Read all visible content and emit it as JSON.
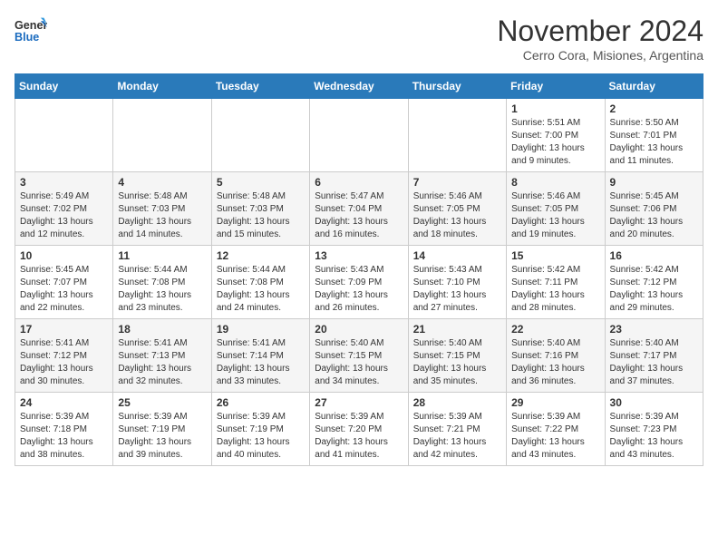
{
  "header": {
    "logo_line1": "General",
    "logo_line2": "Blue",
    "month": "November 2024",
    "location": "Cerro Cora, Misiones, Argentina"
  },
  "weekdays": [
    "Sunday",
    "Monday",
    "Tuesday",
    "Wednesday",
    "Thursday",
    "Friday",
    "Saturday"
  ],
  "weeks": [
    [
      {
        "day": "",
        "info": ""
      },
      {
        "day": "",
        "info": ""
      },
      {
        "day": "",
        "info": ""
      },
      {
        "day": "",
        "info": ""
      },
      {
        "day": "",
        "info": ""
      },
      {
        "day": "1",
        "info": "Sunrise: 5:51 AM\nSunset: 7:00 PM\nDaylight: 13 hours\nand 9 minutes."
      },
      {
        "day": "2",
        "info": "Sunrise: 5:50 AM\nSunset: 7:01 PM\nDaylight: 13 hours\nand 11 minutes."
      }
    ],
    [
      {
        "day": "3",
        "info": "Sunrise: 5:49 AM\nSunset: 7:02 PM\nDaylight: 13 hours\nand 12 minutes."
      },
      {
        "day": "4",
        "info": "Sunrise: 5:48 AM\nSunset: 7:03 PM\nDaylight: 13 hours\nand 14 minutes."
      },
      {
        "day": "5",
        "info": "Sunrise: 5:48 AM\nSunset: 7:03 PM\nDaylight: 13 hours\nand 15 minutes."
      },
      {
        "day": "6",
        "info": "Sunrise: 5:47 AM\nSunset: 7:04 PM\nDaylight: 13 hours\nand 16 minutes."
      },
      {
        "day": "7",
        "info": "Sunrise: 5:46 AM\nSunset: 7:05 PM\nDaylight: 13 hours\nand 18 minutes."
      },
      {
        "day": "8",
        "info": "Sunrise: 5:46 AM\nSunset: 7:05 PM\nDaylight: 13 hours\nand 19 minutes."
      },
      {
        "day": "9",
        "info": "Sunrise: 5:45 AM\nSunset: 7:06 PM\nDaylight: 13 hours\nand 20 minutes."
      }
    ],
    [
      {
        "day": "10",
        "info": "Sunrise: 5:45 AM\nSunset: 7:07 PM\nDaylight: 13 hours\nand 22 minutes."
      },
      {
        "day": "11",
        "info": "Sunrise: 5:44 AM\nSunset: 7:08 PM\nDaylight: 13 hours\nand 23 minutes."
      },
      {
        "day": "12",
        "info": "Sunrise: 5:44 AM\nSunset: 7:08 PM\nDaylight: 13 hours\nand 24 minutes."
      },
      {
        "day": "13",
        "info": "Sunrise: 5:43 AM\nSunset: 7:09 PM\nDaylight: 13 hours\nand 26 minutes."
      },
      {
        "day": "14",
        "info": "Sunrise: 5:43 AM\nSunset: 7:10 PM\nDaylight: 13 hours\nand 27 minutes."
      },
      {
        "day": "15",
        "info": "Sunrise: 5:42 AM\nSunset: 7:11 PM\nDaylight: 13 hours\nand 28 minutes."
      },
      {
        "day": "16",
        "info": "Sunrise: 5:42 AM\nSunset: 7:12 PM\nDaylight: 13 hours\nand 29 minutes."
      }
    ],
    [
      {
        "day": "17",
        "info": "Sunrise: 5:41 AM\nSunset: 7:12 PM\nDaylight: 13 hours\nand 30 minutes."
      },
      {
        "day": "18",
        "info": "Sunrise: 5:41 AM\nSunset: 7:13 PM\nDaylight: 13 hours\nand 32 minutes."
      },
      {
        "day": "19",
        "info": "Sunrise: 5:41 AM\nSunset: 7:14 PM\nDaylight: 13 hours\nand 33 minutes."
      },
      {
        "day": "20",
        "info": "Sunrise: 5:40 AM\nSunset: 7:15 PM\nDaylight: 13 hours\nand 34 minutes."
      },
      {
        "day": "21",
        "info": "Sunrise: 5:40 AM\nSunset: 7:15 PM\nDaylight: 13 hours\nand 35 minutes."
      },
      {
        "day": "22",
        "info": "Sunrise: 5:40 AM\nSunset: 7:16 PM\nDaylight: 13 hours\nand 36 minutes."
      },
      {
        "day": "23",
        "info": "Sunrise: 5:40 AM\nSunset: 7:17 PM\nDaylight: 13 hours\nand 37 minutes."
      }
    ],
    [
      {
        "day": "24",
        "info": "Sunrise: 5:39 AM\nSunset: 7:18 PM\nDaylight: 13 hours\nand 38 minutes."
      },
      {
        "day": "25",
        "info": "Sunrise: 5:39 AM\nSunset: 7:19 PM\nDaylight: 13 hours\nand 39 minutes."
      },
      {
        "day": "26",
        "info": "Sunrise: 5:39 AM\nSunset: 7:19 PM\nDaylight: 13 hours\nand 40 minutes."
      },
      {
        "day": "27",
        "info": "Sunrise: 5:39 AM\nSunset: 7:20 PM\nDaylight: 13 hours\nand 41 minutes."
      },
      {
        "day": "28",
        "info": "Sunrise: 5:39 AM\nSunset: 7:21 PM\nDaylight: 13 hours\nand 42 minutes."
      },
      {
        "day": "29",
        "info": "Sunrise: 5:39 AM\nSunset: 7:22 PM\nDaylight: 13 hours\nand 43 minutes."
      },
      {
        "day": "30",
        "info": "Sunrise: 5:39 AM\nSunset: 7:23 PM\nDaylight: 13 hours\nand 43 minutes."
      }
    ]
  ]
}
